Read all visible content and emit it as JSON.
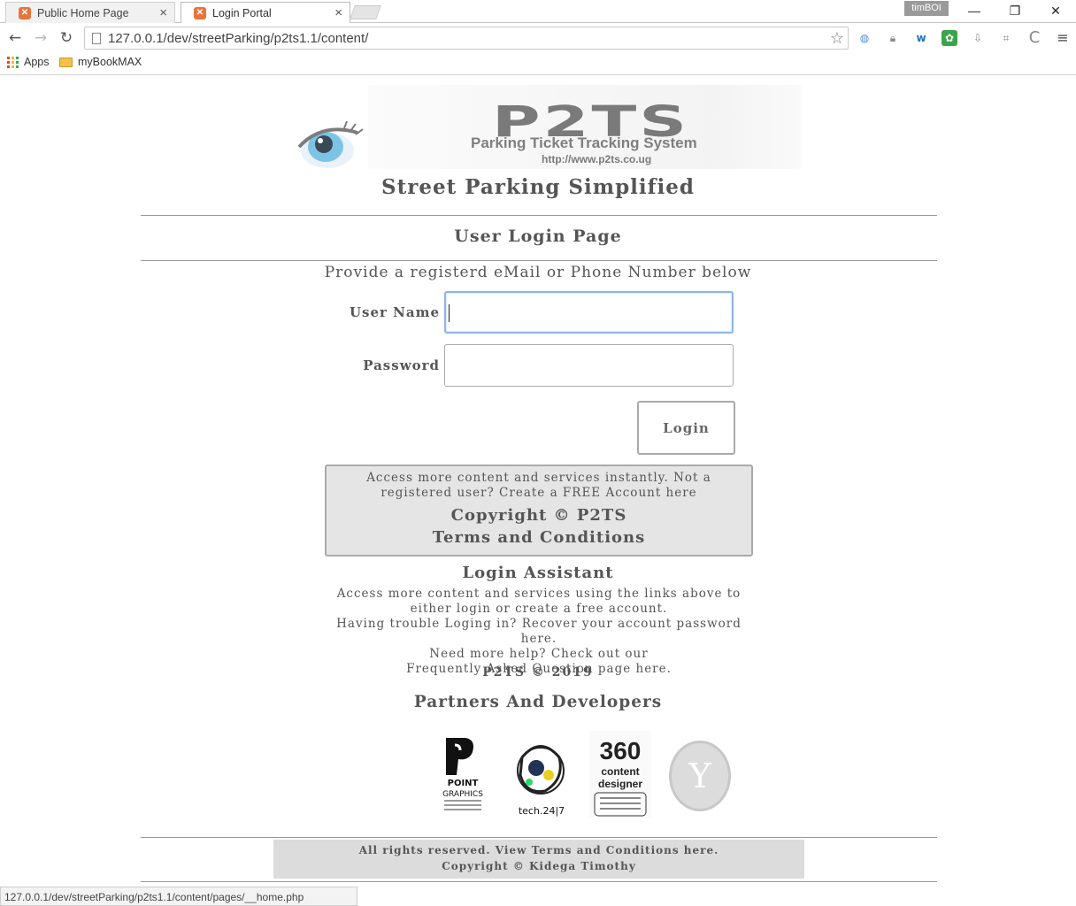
{
  "browser": {
    "tabs": [
      {
        "title": "Public Home Page",
        "active": false
      },
      {
        "title": "Login Portal",
        "active": true
      }
    ],
    "profile_name": "timBOI",
    "url": "127.0.0.1/dev/streetParking/p2ts1.1/content/",
    "bookmarks": [
      {
        "label": "Apps",
        "icon": "apps-grid-icon"
      },
      {
        "label": "myBookMAX",
        "icon": "folder-icon"
      }
    ],
    "status_url": "127.0.0.1/dev/streetParking/p2ts1.1/content/pages/__home.php"
  },
  "logo": {
    "title": "P2TS",
    "subtitle": "Parking Ticket Tracking System",
    "url": "http://www.p2ts.co.ug"
  },
  "tagline": "Street Parking Simplified",
  "page_title": "User Login Page",
  "instruction": "Provide a registerd eMail or Phone Number below",
  "form": {
    "username_label": "User Name",
    "username_value": "",
    "password_label": "Password",
    "password_value": "",
    "login_label": "Login"
  },
  "info_box": {
    "register_text": "Access more content and services instantly. Not a registered user? Create a FREE Account here",
    "copyright": "Copyright © P2TS",
    "terms": "Terms and Conditions"
  },
  "assistant": {
    "title": "Login Assistant",
    "line1": "Access more content and services using the links above to either login or create a free account.",
    "line2": "Having trouble Loging in? Recover your account password here.",
    "line3": "Need more help? Check out our",
    "line4": "Frequently Asked Question page here."
  },
  "year_line": "P2TS © 2019",
  "partners": {
    "title": "Partners And Developers",
    "logos": [
      {
        "name": "Point Graphics",
        "text": "POINT GRAPHICS"
      },
      {
        "name": "Tech 24/7",
        "text": "tech.24|7"
      },
      {
        "name": "360 content designer",
        "text_top": "360",
        "text_mid": "content",
        "text_bottom": "designer"
      },
      {
        "name": "Y",
        "text": "Y"
      }
    ]
  },
  "footer": {
    "rights": "All rights reserved. View Terms and Conditions here.",
    "author": "Copyright © Kidega Timothy"
  },
  "colors": {
    "text": "#555555",
    "info_box_bg": "#e5e5e5",
    "footer_bg": "#dcdcdc",
    "input_focus": "#8fb5e6"
  }
}
